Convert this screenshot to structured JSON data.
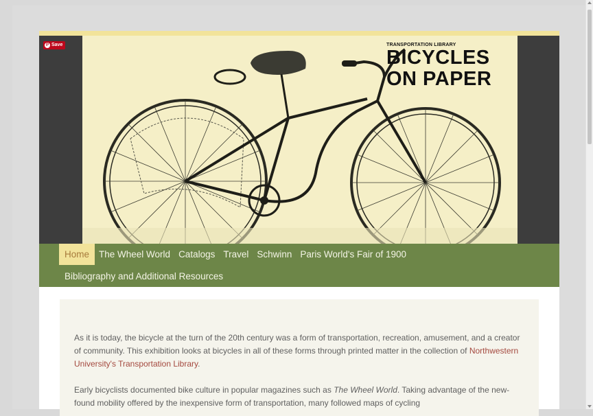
{
  "banner": {
    "save_label": "Save",
    "library_label": "TRANSPORTATION LIBRARY",
    "title_line1": "BICYCLES",
    "title_line2": "ON PAPER"
  },
  "nav": {
    "row1": [
      {
        "label": "Home",
        "active": true
      },
      {
        "label": "The Wheel World"
      },
      {
        "label": "Catalogs"
      },
      {
        "label": "Travel"
      },
      {
        "label": "Schwinn"
      },
      {
        "label": "Paris World's Fair of 1900"
      }
    ],
    "row2": [
      {
        "label": "Bibliography and Additional Resources"
      }
    ]
  },
  "content": {
    "p1_before": "As it is today, the bicycle at the turn of the 20th century was a form of transportation, recreation, amusement, and a creator of community. This exhibition looks at bicycles in all of these forms through printed matter in the collection of ",
    "p1_link": "Northwestern University's Transportation Library",
    "p1_after": ".",
    "p2_before": "Early bicyclists documented bike culture in popular magazines such as ",
    "p2_italic": "The Wheel World",
    "p2_after": ". Taking advantage of the new-found mobility offered by the inexpensive form of transportation, many followed maps of cycling"
  },
  "colors": {
    "nav_bg": "#6d8648",
    "nav_active_bg": "#f2e39a",
    "banner_bg": "#3d3d3d",
    "art_bg": "#f5efc7",
    "link": "#a4493f",
    "save_red": "#bd081c"
  }
}
